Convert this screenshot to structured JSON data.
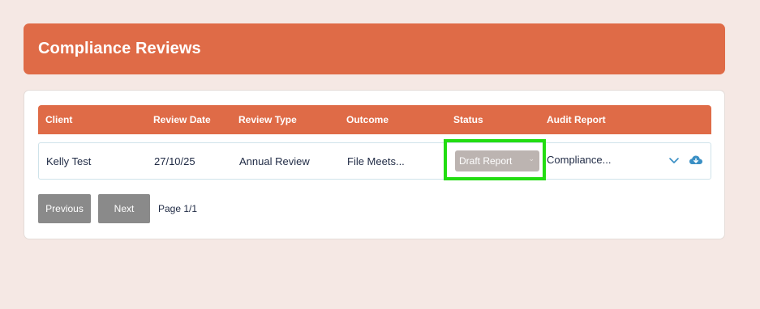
{
  "page": {
    "title": "Compliance Reviews"
  },
  "table": {
    "columns": [
      "Client",
      "Review Date",
      "Review Type",
      "Outcome",
      "Status",
      "Audit Report"
    ],
    "rows": [
      {
        "client": "Kelly Test",
        "review_date": "27/10/25",
        "review_type": "Annual Review",
        "outcome": "File Meets...",
        "status": "Draft Report",
        "audit_report": "Compliance..."
      }
    ]
  },
  "pagination": {
    "previous_label": "Previous",
    "next_label": "Next",
    "page_info": "Page 1/1"
  },
  "icons": {
    "status_dropdown": "chevron-down-icon",
    "row_expand": "chevron-down-icon",
    "download": "cloud-download-icon"
  },
  "colors": {
    "brand": "#df6b47",
    "background": "#f5e8e4",
    "highlight": "#22dd11",
    "button": "#8a8a8a",
    "status_select": "#bcb4b1",
    "icon_blue": "#3a8fc4"
  }
}
